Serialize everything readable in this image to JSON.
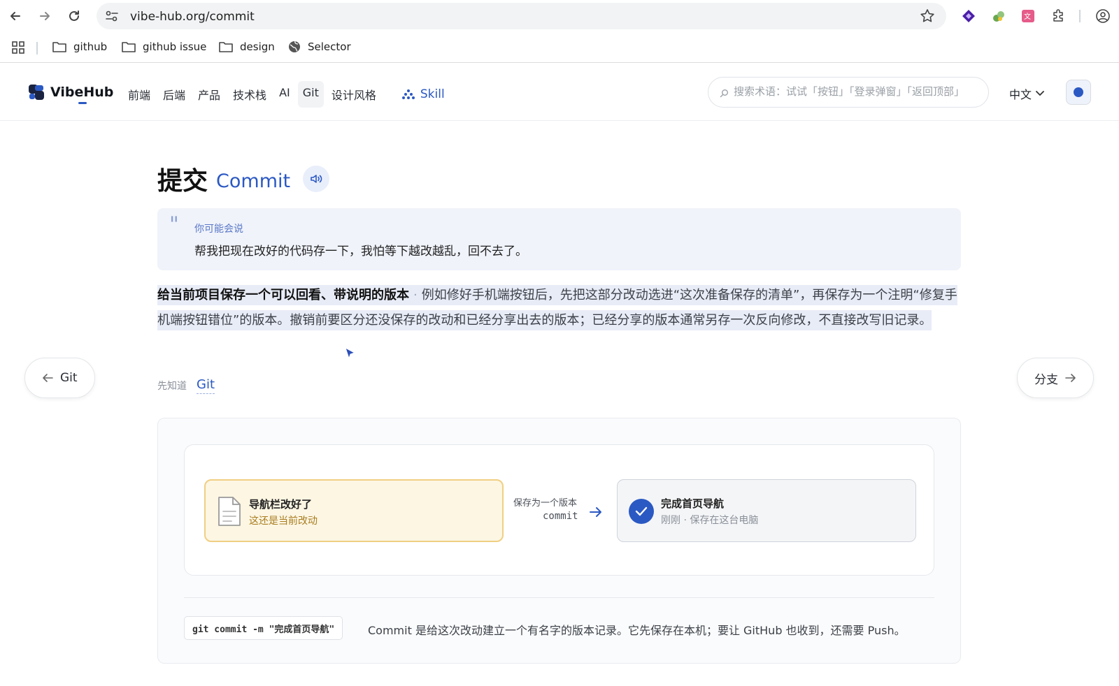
{
  "browser": {
    "url": "vibe-hub.org/commit",
    "bookmarks": [
      "github",
      "github issue",
      "design",
      "Selector"
    ]
  },
  "header": {
    "logo_text": "VibeHub",
    "nav": [
      "前端",
      "后端",
      "产品",
      "技术栈",
      "AI",
      "Git",
      "设计风格"
    ],
    "active_nav": "Git",
    "skill_label": "Skill",
    "search_placeholder": "搜索术语：试试「按钮」「登录弹窗」「返回顶部」",
    "language": "中文"
  },
  "page": {
    "title_zh": "提交",
    "title_en": "Commit",
    "quote_label": "你可能会说",
    "quote_text": "帮我把现在改好的代码存一下，我怕等下越改越乱，回不去了。",
    "definition_bold": "给当前项目保存一个可以回看、带说明的版本",
    "definition_sep": "·",
    "definition_text": "例如修好手机端按钮后，先把这部分改动选进“这次准备保存的清单”，再保存为一个注明“修复手机端按钮错位”的版本。撤销前要区分还没保存的改动和已经分享出去的版本；已经分享的版本通常另存一次反向修改，不直接改写旧记录。",
    "prev_label": "Git",
    "next_label": "分支",
    "prereq_label": "先知道",
    "prereq_link": "Git"
  },
  "demo": {
    "change_title": "导航栏改好了",
    "change_sub": "这还是当前改动",
    "arrow_label": "保存为一个版本",
    "arrow_code": "commit",
    "commit_title": "完成首页导航",
    "commit_sub": "刚刚 · 保存在这台电脑",
    "command": "git commit -m \"完成首页导航\"",
    "command_desc": "Commit 是给这次改动建立一个有名字的版本记录。它先保存在本机；要让 GitHub 也收到，还需要 Push。"
  },
  "colors": {
    "accent": "#2b59c3",
    "change_bg": "#fcf6e3",
    "change_border": "#f0cf83",
    "quote_bg": "#f0f3fa"
  }
}
